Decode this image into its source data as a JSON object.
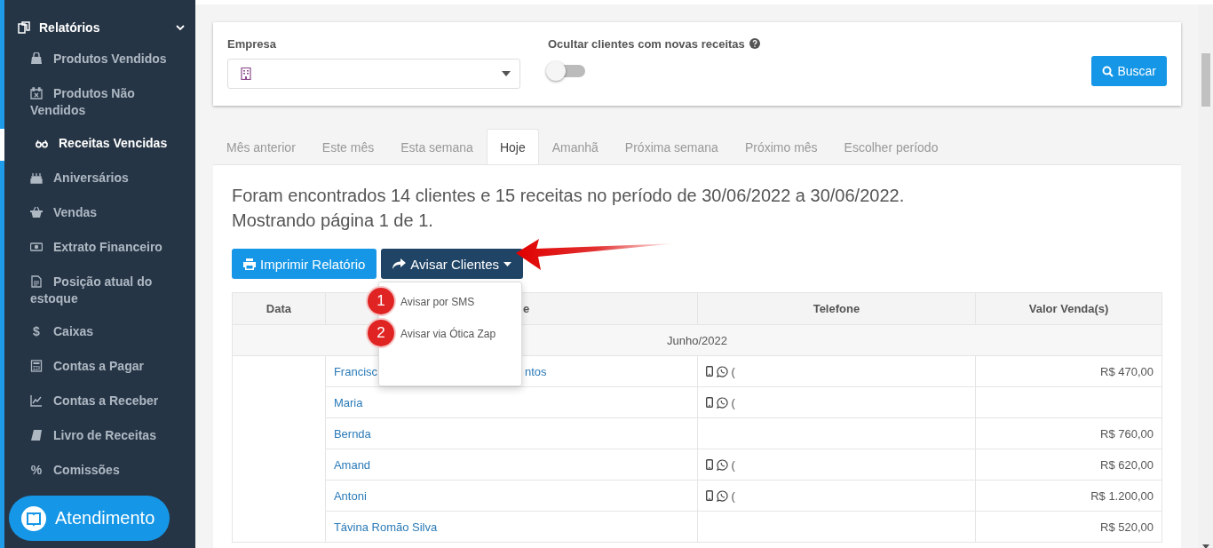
{
  "sidebar": {
    "section": {
      "label": "Relatórios",
      "expanded": true
    },
    "items": [
      {
        "label": "Produtos Vendidos",
        "selected": false
      },
      {
        "label": "Produtos Não Vendidos",
        "selected": false
      },
      {
        "label": "Receitas Vencidas",
        "selected": true
      },
      {
        "label": "Aniversários",
        "selected": false
      },
      {
        "label": "Vendas",
        "selected": false
      },
      {
        "label": "Extrato Financeiro",
        "selected": false
      },
      {
        "label": "Posição atual do estoque",
        "selected": false
      },
      {
        "label": "Caixas",
        "selected": false,
        "icon_text": "$"
      },
      {
        "label": "Contas a Pagar",
        "selected": false
      },
      {
        "label": "Contas a Receber",
        "selected": false
      },
      {
        "label": "Livro de Receitas",
        "selected": false
      },
      {
        "label": "Comissões",
        "selected": false,
        "icon_text": "%"
      }
    ]
  },
  "support_button": {
    "label": "Atendimento"
  },
  "filters": {
    "company": {
      "label": "Empresa"
    },
    "hide_new": {
      "label": "Ocultar clientes com novas receitas",
      "on": false
    },
    "search_button": "Buscar"
  },
  "tabs": [
    {
      "label": "Mês anterior",
      "selected": false
    },
    {
      "label": "Este mês",
      "selected": false
    },
    {
      "label": "Esta semana",
      "selected": false
    },
    {
      "label": "Hoje",
      "selected": true
    },
    {
      "label": "Amanhã",
      "selected": false
    },
    {
      "label": "Próxima semana",
      "selected": false
    },
    {
      "label": "Próximo mês",
      "selected": false
    },
    {
      "label": "Escolher período",
      "selected": false
    }
  ],
  "summary": [
    "Foram encontrados 14 clientes e 15 receitas no período de 30/06/2022 a 30/06/2022.",
    "Mostrando página 1 de 1."
  ],
  "buttons": {
    "print": "Imprimir Relatório",
    "notify": "Avisar Clientes"
  },
  "notify_menu": [
    {
      "label": "Avisar por SMS",
      "badge": "1"
    },
    {
      "label": "Avisar via Ótica Zap",
      "badge": "2"
    }
  ],
  "table": {
    "columns": [
      "Data",
      "e",
      "Telefone",
      "Valor Venda(s)"
    ],
    "group": "Junho/2022",
    "rows": [
      {
        "name": "Francisc",
        "name_tail": "ntos",
        "phone": "(",
        "value": "R$ 470,00"
      },
      {
        "name": "Maria",
        "phone": "("
      },
      {
        "name": "Bernda",
        "value": "R$ 760,00"
      },
      {
        "name": "Amand",
        "phone": "(",
        "value": "R$ 620,00"
      },
      {
        "name": "Antoni",
        "phone": "(",
        "value": "R$ 1.200,00"
      },
      {
        "name": "Távina Romão Silva",
        "value": "R$ 520,00"
      }
    ]
  }
}
